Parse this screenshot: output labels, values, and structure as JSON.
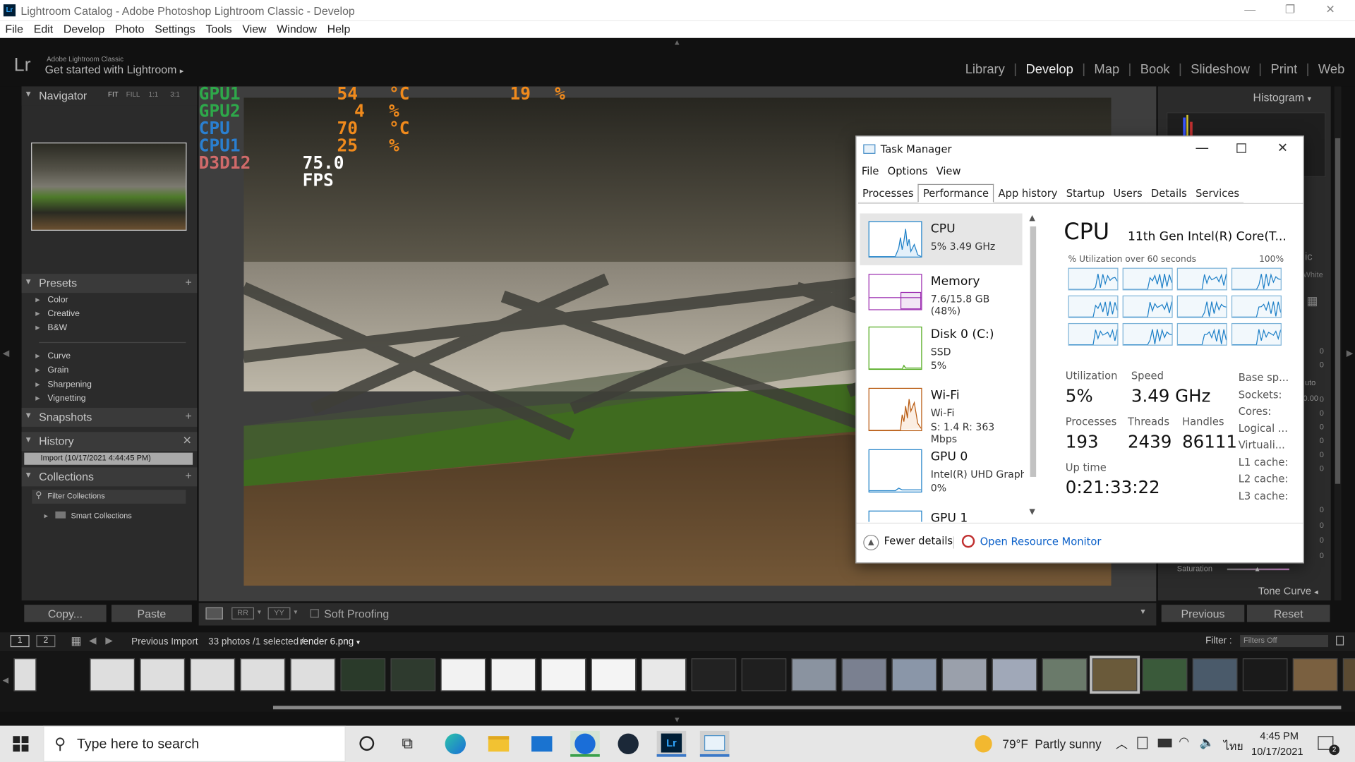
{
  "window": {
    "title": "Lightroom Catalog - Adobe Photoshop Lightroom Classic - Develop",
    "min": "—",
    "max": "❐",
    "close": "✕"
  },
  "menu": [
    "File",
    "Edit",
    "Develop",
    "Photo",
    "Settings",
    "Tools",
    "View",
    "Window",
    "Help"
  ],
  "lr": {
    "logo": "Lr",
    "brand_small": "Adobe Lightroom Classic",
    "brand_big": "Get started with Lightroom",
    "arrow": "▸"
  },
  "modules": [
    "Library",
    "Develop",
    "Map",
    "Book",
    "Slideshow",
    "Print",
    "Web"
  ],
  "left_panel": {
    "navigator": {
      "title": "Navigator",
      "zoom": [
        "FIT",
        "FILL",
        "1:1",
        "3:1"
      ]
    },
    "presets": {
      "title": "Presets",
      "groups1": [
        "Color",
        "Creative",
        "B&W"
      ],
      "groups2": [
        "Curve",
        "Grain",
        "Sharpening",
        "Vignetting"
      ]
    },
    "snapshots": "Snapshots",
    "history": "History",
    "history_item": "Import (10/17/2021 4:44:45 PM)",
    "collections": "Collections",
    "filter_collections": "Filter Collections",
    "smart_collections": "Smart Collections",
    "copy": "Copy...",
    "paste": "Paste"
  },
  "overlay": {
    "rows": [
      {
        "name": "GPU1",
        "v1": "54",
        "u1": "°C",
        "v2": "19",
        "u2": "%",
        "color": "#2ea84a"
      },
      {
        "name": "GPU2",
        "v1": "4",
        "u1": "%",
        "v2": "",
        "u2": "",
        "color": "#2ea84a"
      },
      {
        "name": "CPU",
        "v1": "70",
        "u1": "°C",
        "v2": "",
        "u2": "",
        "color": "#2a7fd0"
      },
      {
        "name": "CPU1",
        "v1": "25",
        "u1": "%",
        "v2": "",
        "u2": "",
        "color": "#2a7fd0"
      }
    ],
    "d3d": "D3D12",
    "fps": "75.0 FPS",
    "d3d_color": "#d06a6a",
    "value_color": "#f08a1c"
  },
  "toolbar": {
    "soft_proofing": "Soft Proofing"
  },
  "right_panel": {
    "histogram": "Histogram",
    "tone_curve": "Tone Curve",
    "saturation": "Saturation",
    "previous": "Previous",
    "reset": "Reset",
    "partial": [
      "ic",
      "White",
      "uto",
      "0.00"
    ],
    "zeros": [
      "0",
      "0",
      "0",
      "0",
      "0",
      "0",
      "0",
      "0",
      "0",
      "0",
      "0",
      "0",
      "0",
      "0",
      "0"
    ]
  },
  "filmstrip": {
    "view1": "1",
    "view2": "2",
    "source": "Previous Import",
    "count": "33 photos /1 selected /",
    "file": "render 6.png",
    "filter_label": "Filter :",
    "filter_value": "Filters Off",
    "selected_index": 21
  },
  "taskmgr": {
    "title": "Task Manager",
    "menu": [
      "File",
      "Options",
      "View"
    ],
    "tabs": [
      "Processes",
      "Performance",
      "App history",
      "Startup",
      "Users",
      "Details",
      "Services"
    ],
    "active_tab": "Performance",
    "list": [
      {
        "name": "CPU",
        "l1": "5% 3.49 GHz",
        "l2": "",
        "l3": "",
        "color": "#1c7fc7",
        "fill": "#e3f0fa"
      },
      {
        "name": "Memory",
        "l1": "7.6/15.8 GB (48%)",
        "l2": "",
        "l3": "",
        "color": "#9b2cb0",
        "fill": "#f2e6f5"
      },
      {
        "name": "Disk 0 (C:)",
        "l1": "SSD",
        "l2": "5%",
        "l3": "",
        "color": "#4da818",
        "fill": "#eef7e6"
      },
      {
        "name": "Wi-Fi",
        "l1": "Wi-Fi",
        "l2": "S: 1.4 R: 363 Mbps",
        "l3": "",
        "color": "#b85a10",
        "fill": "#fbeee3"
      },
      {
        "name": "GPU 0",
        "l1": "Intel(R) UHD Graphic",
        "l2": "0%",
        "l3": "",
        "color": "#1c7fc7",
        "fill": "#e3f0fa"
      },
      {
        "name": "GPU 1",
        "l1": "",
        "l2": "",
        "l3": "",
        "color": "#1c7fc7",
        "fill": "#e3f0fa"
      }
    ],
    "cpu_title": "CPU",
    "cpu_model": "11th Gen Intel(R) Core(T...",
    "util_label": "% Utilization over 60 seconds",
    "util_max": "100%",
    "stats": {
      "utilization_label": "Utilization",
      "utilization": "5%",
      "speed_label": "Speed",
      "speed": "3.49 GHz",
      "processes_label": "Processes",
      "processes": "193",
      "threads_label": "Threads",
      "threads": "2439",
      "handles_label": "Handles",
      "handles": "86111",
      "uptime_label": "Up time",
      "uptime": "0:21:33:22"
    },
    "side": [
      "Base sp...",
      "Sockets:",
      "Cores:",
      "Logical ...",
      "Virtuali...",
      "L1 cache:",
      "L2 cache:",
      "L3 cache:"
    ],
    "fewer": "Fewer details",
    "resmon": "Open Resource Monitor"
  },
  "taskbar": {
    "search": "Type here to search",
    "weather": "79°F  Partly sunny",
    "lang": "ไทย",
    "time": "4:45 PM",
    "date": "10/17/2021",
    "notif": "2"
  },
  "colors": {
    "lr_bg": "#2b2b2b",
    "accent": "#1c7fc7",
    "taskbar": "#e6e6e6"
  }
}
